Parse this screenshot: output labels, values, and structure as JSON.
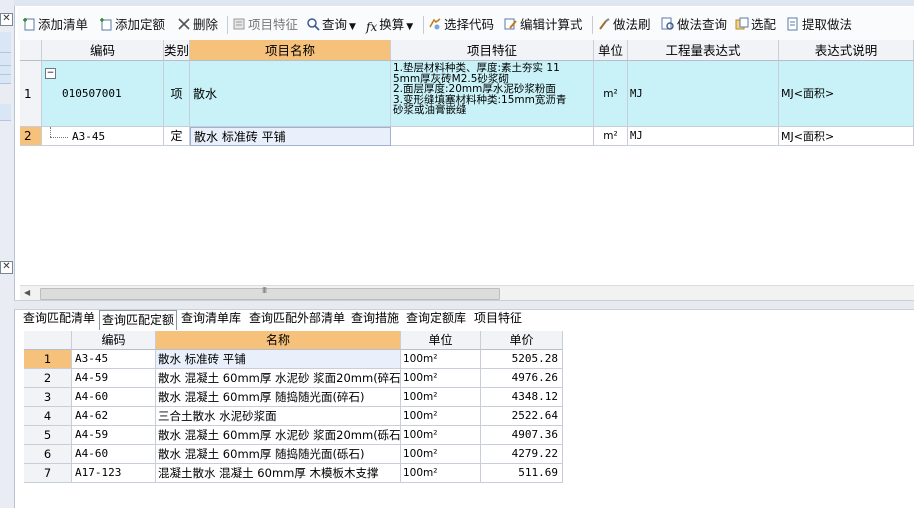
{
  "toolbar": {
    "add_list": "添加清单",
    "add_quota": "添加定额",
    "delete": "删除",
    "item_feature": "项目特征",
    "query": "查询",
    "replace": "换算",
    "select_code": "选择代码",
    "edit_formula": "编辑计算式",
    "method_brush": "做法刷",
    "method_query": "做法查询",
    "select_match": "选配",
    "extract_method": "提取做法"
  },
  "top_grid": {
    "headers": [
      "编码",
      "类别",
      "项目名称",
      "项目特征",
      "单位",
      "工程量表达式",
      "表达式说明"
    ],
    "rows": [
      {
        "num": "1",
        "toggle": "−",
        "code": "010507001",
        "category": "项",
        "name": "散水",
        "feature": "1.垫层材料种类、厚度:素土夯实 11\n5mm厚灰砖M2.5砂浆砌\n2.面层厚度:20mm厚水泥砂浆粉面\n3.变形缝填塞材料种类:15mm宽沥青\n砂浆或油膏嵌缝",
        "unit": "m²",
        "expr": "MJ",
        "expr_desc": "MJ<面积>"
      },
      {
        "num": "2",
        "code": "A3-45",
        "category": "定",
        "name": "散水 标准砖 平铺",
        "feature": "",
        "unit": "m²",
        "expr": "MJ",
        "expr_desc": "MJ<面积>"
      }
    ]
  },
  "scroll_grip": "III",
  "tabs": [
    "查询匹配清单",
    "查询匹配定额",
    "查询清单库",
    "查询匹配外部清单",
    "查询措施",
    "查询定额库",
    "项目特征"
  ],
  "active_tab": "查询匹配定额",
  "bottom_grid": {
    "headers": [
      "编码",
      "名称",
      "单位",
      "单价"
    ],
    "rows": [
      {
        "num": "1",
        "code": "A3-45",
        "name": "散水 标准砖 平铺",
        "unit": "100m²",
        "price": "5205.28"
      },
      {
        "num": "2",
        "code": "A4-59",
        "name": "散水 混凝土 60mm厚 水泥砂 浆面20mm(碎石)",
        "unit": "100m²",
        "price": "4976.26"
      },
      {
        "num": "3",
        "code": "A4-60",
        "name": "散水 混凝土 60mm厚 随捣随光面(碎石)",
        "unit": "100m²",
        "price": "4348.12"
      },
      {
        "num": "4",
        "code": "A4-62",
        "name": "三合土散水 水泥砂浆面",
        "unit": "100m²",
        "price": "2522.64"
      },
      {
        "num": "5",
        "code": "A4-59",
        "name": "散水 混凝土 60mm厚 水泥砂 浆面20mm(砾石)",
        "unit": "100m²",
        "price": "4907.36"
      },
      {
        "num": "6",
        "code": "A4-60",
        "name": "散水 混凝土 60mm厚 随捣随光面(砾石)",
        "unit": "100m²",
        "price": "4279.22"
      },
      {
        "num": "7",
        "code": "A17-123",
        "name": "混凝土散水 混凝土 60mm厚 木模板木支撑",
        "unit": "100m²",
        "price": "511.69"
      }
    ]
  },
  "colors": {
    "selected_header": "#f6c17a",
    "list_row": "#c8f2f8",
    "header_bg": "#f1f3f6"
  }
}
